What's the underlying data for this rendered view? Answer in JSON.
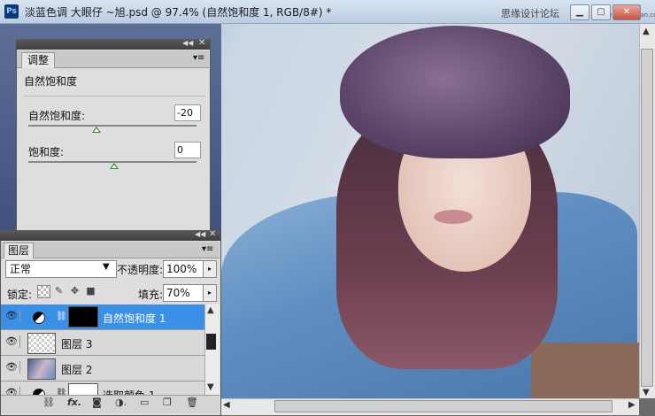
{
  "window": {
    "title": "淡蓝色调 大眼仔 ~旭.psd @ 97.4% (自然饱和度 1, RGB/8#) *",
    "app_icon_label": "Ps",
    "site_mark": "思缘设计论坛",
    "site_url": "www.missyuan.com"
  },
  "adjustments_panel": {
    "tab": "调整",
    "heading": "自然饱和度",
    "vibrance_label": "自然饱和度:",
    "vibrance_value": "-20",
    "vibrance_level": -20,
    "saturation_label": "饱和度:",
    "saturation_value": "0",
    "saturation_level": 0
  },
  "layers_panel": {
    "tab": "图层",
    "blend_mode": "正常",
    "opacity_label": "不透明度:",
    "opacity_value": "100%",
    "lock_label": "锁定:",
    "fill_label": "填充:",
    "fill_value": "70%",
    "layers": [
      {
        "name": "自然饱和度 1",
        "selected": true,
        "type": "adjustment"
      },
      {
        "name": "图层 3",
        "selected": false,
        "type": "transparent"
      },
      {
        "name": "图层 2",
        "selected": false,
        "type": "photo"
      },
      {
        "name": "选取颜色 1",
        "selected": false,
        "type": "adjustment"
      }
    ]
  },
  "icons": [
    "eye-icon",
    "link-icon",
    "fx-icon",
    "mask-icon",
    "adjustment-icon",
    "folder-icon",
    "new-layer-icon",
    "trash-icon"
  ],
  "colors": {
    "selection": "#3a8fe6",
    "panel": "#dedede",
    "titlebar": "#c9d8ea"
  }
}
